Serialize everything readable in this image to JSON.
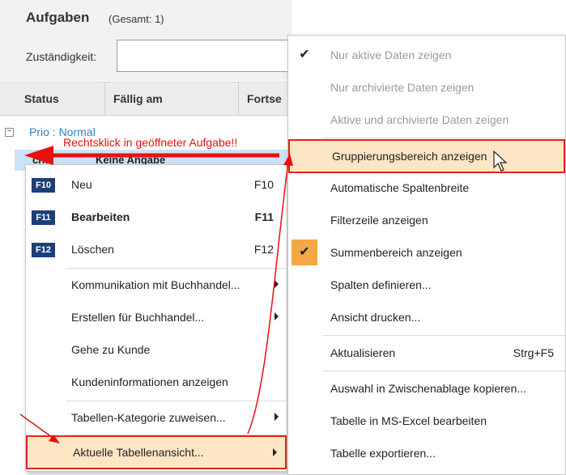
{
  "window": {
    "title": "Aufgaben",
    "count": "(Gesamt: 1)",
    "responsibility_label": "Zuständigkeit:",
    "responsibility_value": ""
  },
  "columns": [
    "Status",
    "Fällig am",
    "Fortse"
  ],
  "group": {
    "toggle": "−",
    "label": "Prio : Normal"
  },
  "row": {
    "status": "cht",
    "due": "Keine Angabe"
  },
  "annotation": "Rechtsklick in geöffneter Aufgabe!!",
  "menu1": {
    "items": [
      {
        "key": "F10",
        "label": "Neu",
        "shortcut": "F10"
      },
      {
        "key": "F11",
        "label": "Bearbeiten",
        "shortcut": "F11"
      },
      {
        "key": "F12",
        "label": "Löschen",
        "shortcut": "F12"
      },
      {
        "label": "Kommunikation mit Buchhandel..."
      },
      {
        "label": "Erstellen für Buchhandel..."
      },
      {
        "label": "Gehe zu Kunde"
      },
      {
        "label": "Kundeninformationen anzeigen"
      },
      {
        "label": "Tabellen-Kategorie zuweisen..."
      },
      {
        "label": "Aktuelle Tabellenansicht..."
      }
    ]
  },
  "menu2": {
    "items": [
      {
        "label": "Nur aktive Daten zeigen",
        "check": "✔"
      },
      {
        "label": "Nur archivierte Daten zeigen"
      },
      {
        "label": "Aktive und archivierte Daten zeigen"
      },
      {
        "label": "Gruppierungsbereich anzeigen"
      },
      {
        "label": "Automatische Spaltenbreite"
      },
      {
        "label": "Filterzeile anzeigen"
      },
      {
        "label": "Summenbereich anzeigen",
        "check": "✔"
      },
      {
        "label": "Spalten definieren..."
      },
      {
        "label": "Ansicht drucken..."
      },
      {
        "label": "Aktualisieren",
        "shortcut": "Strg+F5"
      },
      {
        "label": "Auswahl in Zwischenablage kopieren..."
      },
      {
        "label": "Tabelle in MS-Excel bearbeiten"
      },
      {
        "label": "Tabelle exportieren..."
      }
    ]
  },
  "colors": {
    "highlight_border": "#e22222",
    "highlight_fill": "#fde6c4",
    "check_fill": "#f5a646",
    "fkey_badge": "#1d3f7a",
    "group_label": "#2f7fc0",
    "annotation": "#e8110e"
  }
}
